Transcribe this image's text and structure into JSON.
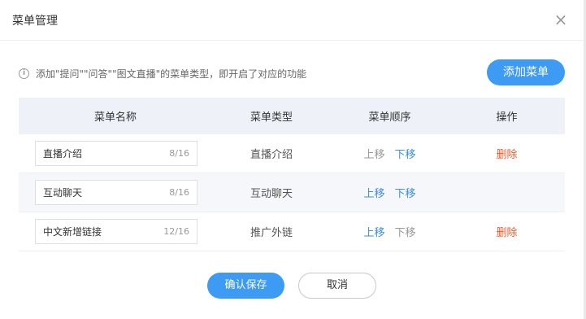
{
  "dialog": {
    "title": "菜单管理",
    "close_icon": "×"
  },
  "tip": {
    "icon": "i",
    "text": "添加\"提问\"\"问答\"\"图文直播\"的菜单类型，即开启了对应的功能"
  },
  "add_button": "添加菜单",
  "table": {
    "headers": {
      "name": "菜单名称",
      "type": "菜单类型",
      "order": "菜单顺序",
      "op": "操作"
    },
    "rows": [
      {
        "name": "直播介绍",
        "count": "8/16",
        "type": "直播介绍",
        "up": "上移",
        "down": "下移",
        "up_enabled": false,
        "down_enabled": true,
        "delete": "删除"
      },
      {
        "name": "互动聊天",
        "count": "8/16",
        "type": "互动聊天",
        "up": "上移",
        "down": "下移",
        "up_enabled": true,
        "down_enabled": true,
        "delete": ""
      },
      {
        "name": "中文新增链接",
        "count": "12/16",
        "type": "推广外链",
        "up": "上移",
        "down": "下移",
        "up_enabled": true,
        "down_enabled": false,
        "delete": "删除"
      }
    ]
  },
  "footer": {
    "save": "确认保存",
    "cancel": "取消"
  },
  "colors": {
    "primary": "#3d9bf3",
    "link": "#3d8fe0",
    "danger": "#e85a2b",
    "disabled": "#999999",
    "header_bg": "#eef2f8"
  }
}
